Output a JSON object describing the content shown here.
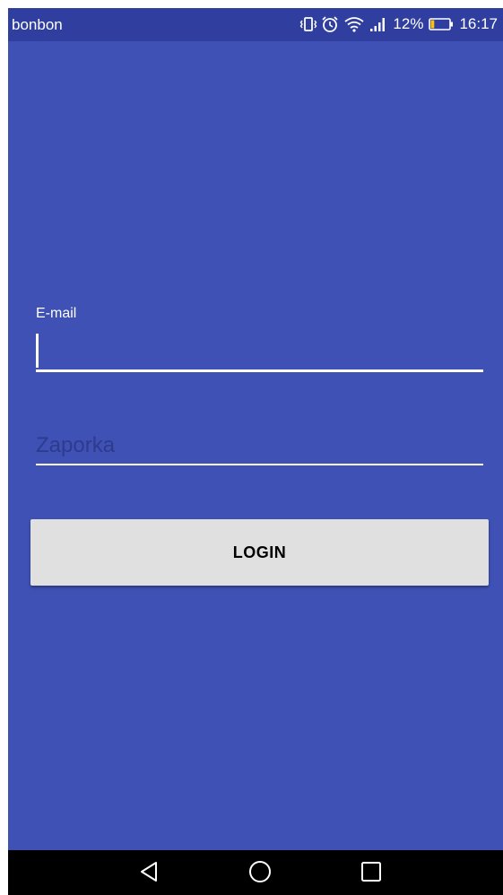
{
  "status_bar": {
    "app_name": "bonbon",
    "battery_percent": "12%",
    "time": "16:17",
    "icons": [
      "vibrate-icon",
      "alarm-icon",
      "wifi-icon",
      "signal-icon",
      "battery-icon"
    ],
    "battery_level": 0.12,
    "battery_fill_color": "#ffc107"
  },
  "login_form": {
    "email_label": "E-mail",
    "email_value": "",
    "password_placeholder": "Zaporka",
    "password_value": "",
    "login_label": "LOGIN"
  },
  "nav_bar": {
    "icons": [
      "back-icon",
      "home-icon",
      "recents-icon"
    ]
  },
  "colors": {
    "background": "#3f51b5",
    "status_bar": "#303f9f",
    "button": "#e0e0e0",
    "nav_bar": "#000000"
  }
}
